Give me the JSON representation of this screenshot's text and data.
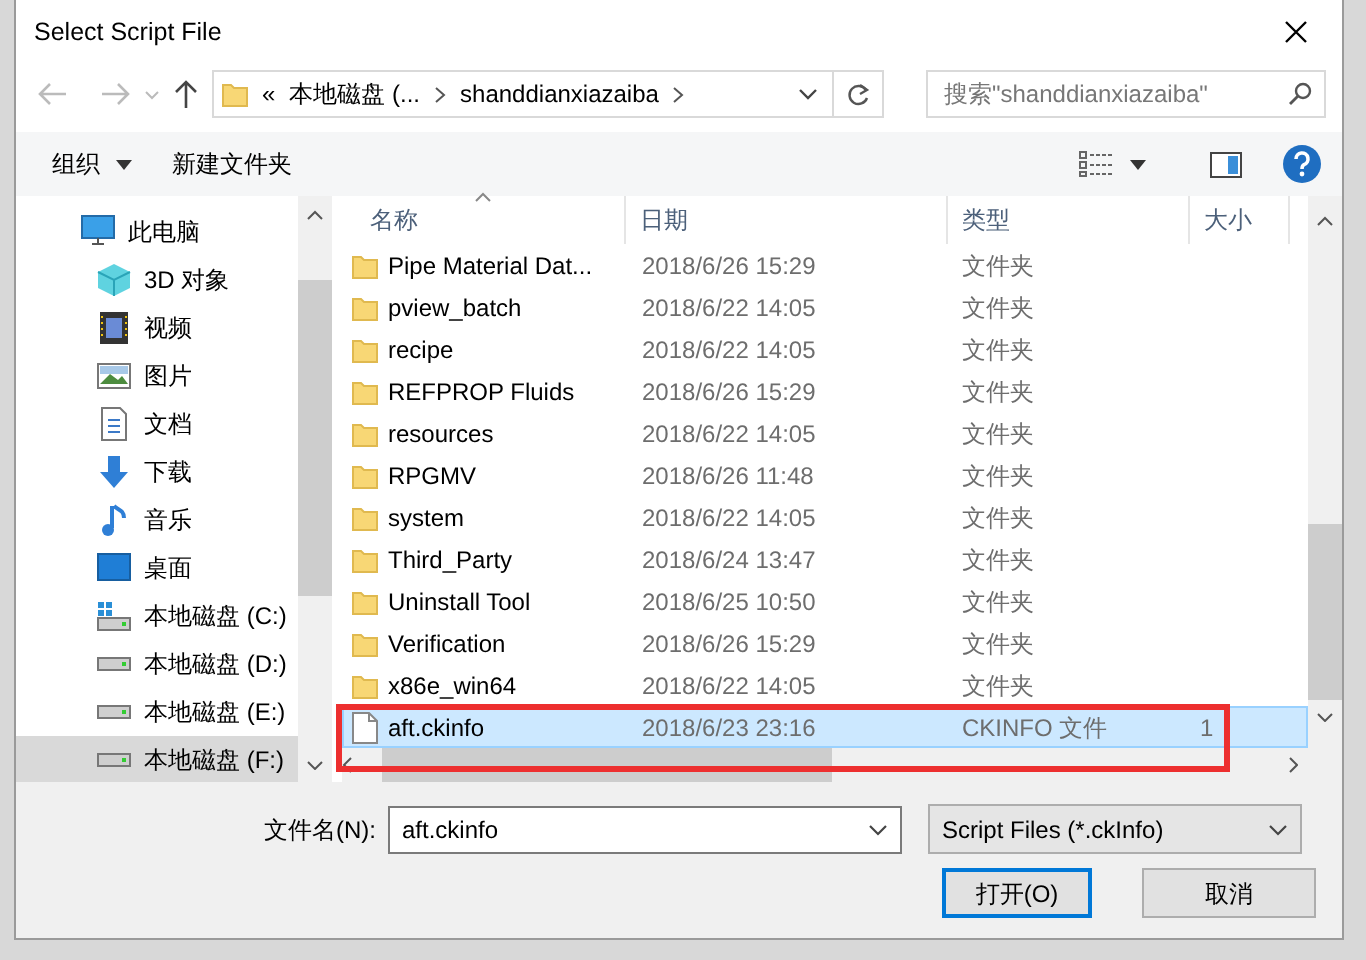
{
  "window": {
    "title": "Select Script File"
  },
  "address_bar": {
    "prefix": "«",
    "segments": [
      "本地磁盘 (...",
      "shanddianxiazaiba"
    ]
  },
  "search": {
    "placeholder": "搜索\"shanddianxiazaiba\""
  },
  "toolbar": {
    "organize": "组织",
    "new_folder": "新建文件夹"
  },
  "sidebar": {
    "items": [
      {
        "label": "此电脑",
        "kind": "pc",
        "selected": false
      },
      {
        "label": "3D 对象",
        "kind": "cube",
        "selected": false
      },
      {
        "label": "视频",
        "kind": "video",
        "selected": false
      },
      {
        "label": "图片",
        "kind": "pictures",
        "selected": false
      },
      {
        "label": "文档",
        "kind": "documents",
        "selected": false
      },
      {
        "label": "下载",
        "kind": "downloads",
        "selected": false
      },
      {
        "label": "音乐",
        "kind": "music",
        "selected": false
      },
      {
        "label": "桌面",
        "kind": "desktop",
        "selected": false
      },
      {
        "label": "本地磁盘 (C:)",
        "kind": "system-drive",
        "selected": false
      },
      {
        "label": "本地磁盘 (D:)",
        "kind": "drive",
        "selected": false
      },
      {
        "label": "本地磁盘 (E:)",
        "kind": "drive",
        "selected": false
      },
      {
        "label": "本地磁盘 (F:)",
        "kind": "drive",
        "selected": true
      }
    ]
  },
  "file_list": {
    "columns": [
      "名称",
      "日期",
      "类型",
      "大小"
    ],
    "rows": [
      {
        "name": "Pipe Material Dat...",
        "date": "2018/6/26 15:29",
        "type": "文件夹",
        "kind": "folder",
        "selected": false
      },
      {
        "name": "pview_batch",
        "date": "2018/6/22 14:05",
        "type": "文件夹",
        "kind": "folder",
        "selected": false
      },
      {
        "name": "recipe",
        "date": "2018/6/22 14:05",
        "type": "文件夹",
        "kind": "folder",
        "selected": false
      },
      {
        "name": "REFPROP Fluids",
        "date": "2018/6/26 15:29",
        "type": "文件夹",
        "kind": "folder",
        "selected": false
      },
      {
        "name": "resources",
        "date": "2018/6/22 14:05",
        "type": "文件夹",
        "kind": "folder",
        "selected": false
      },
      {
        "name": "RPGMV",
        "date": "2018/6/26 11:48",
        "type": "文件夹",
        "kind": "folder",
        "selected": false
      },
      {
        "name": "system",
        "date": "2018/6/22 14:05",
        "type": "文件夹",
        "kind": "folder",
        "selected": false
      },
      {
        "name": "Third_Party",
        "date": "2018/6/24 13:47",
        "type": "文件夹",
        "kind": "folder",
        "selected": false
      },
      {
        "name": "Uninstall Tool",
        "date": "2018/6/25 10:50",
        "type": "文件夹",
        "kind": "folder",
        "selected": false
      },
      {
        "name": "Verification",
        "date": "2018/6/26 15:29",
        "type": "文件夹",
        "kind": "folder",
        "selected": false
      },
      {
        "name": "x86e_win64",
        "date": "2018/6/22 14:05",
        "type": "文件夹",
        "kind": "folder",
        "selected": false
      },
      {
        "name": "aft.ckinfo",
        "date": "2018/6/23 23:16",
        "type": "CKINFO 文件",
        "size": "1",
        "kind": "file",
        "selected": true
      }
    ]
  },
  "filename": {
    "label": "文件名(N):",
    "value": "aft.ckinfo"
  },
  "filter": {
    "value": "Script Files (*.ckInfo)"
  },
  "buttons": [
    {
      "label": "打开(O)",
      "default": true
    },
    {
      "label": "取消",
      "default": false
    }
  ]
}
